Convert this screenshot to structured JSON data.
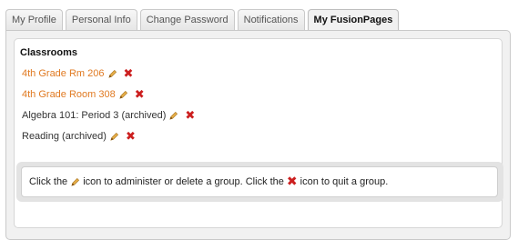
{
  "tabs": [
    {
      "label": "My Profile",
      "active": false
    },
    {
      "label": "Personal Info",
      "active": false
    },
    {
      "label": "Change Password",
      "active": false
    },
    {
      "label": "Notifications",
      "active": false
    },
    {
      "label": "My FusionPages",
      "active": true
    }
  ],
  "classrooms": {
    "heading": "Classrooms",
    "items": [
      {
        "name": "4th Grade Rm 206",
        "link": true
      },
      {
        "name": "4th Grade Room 308",
        "link": true
      },
      {
        "name": "Algebra 101: Period 3 (archived)",
        "link": false
      },
      {
        "name": "Reading (archived)",
        "link": false
      }
    ]
  },
  "note": {
    "part1": "Click the",
    "part2": "icon to administer or delete a group. Click the",
    "part3": "icon to quit a group."
  },
  "colors": {
    "link": "#e07a22",
    "delete_icon": "#cc1f1f",
    "pencil_icon": "#e8b04a"
  },
  "icons": {
    "edit": "pencil-icon",
    "delete": "x-icon"
  }
}
